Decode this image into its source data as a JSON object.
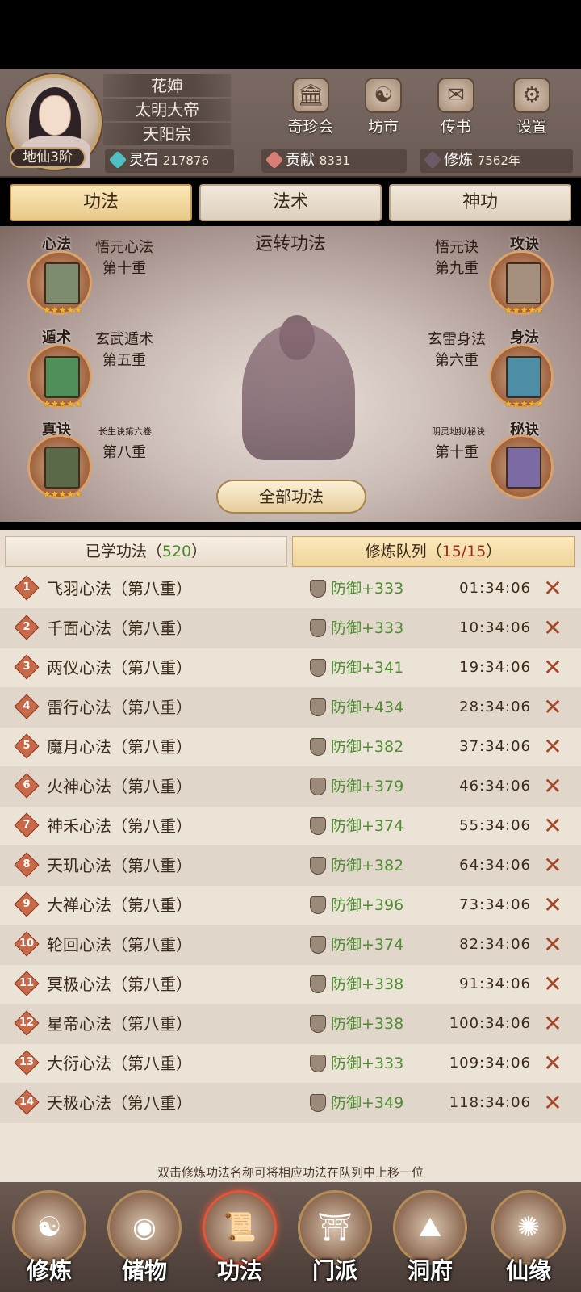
{
  "profile": {
    "name": "花婶",
    "title": "太明大帝",
    "sect": "天阳宗",
    "rank": "地仙3阶"
  },
  "top_buttons": [
    {
      "label": "奇珍会",
      "icon": "treasure-shop-icon"
    },
    {
      "label": "坊市",
      "icon": "market-icon"
    },
    {
      "label": "传书",
      "icon": "scroll-mail-icon"
    },
    {
      "label": "设置",
      "icon": "gear-icon"
    }
  ],
  "resources": {
    "spirit_stone": {
      "label": "灵石",
      "value": "217876",
      "color": "#4fbfc4"
    },
    "contribution": {
      "label": "贡献",
      "value": "8331",
      "color": "#d77f77"
    },
    "cultivation": {
      "label": "修炼",
      "value": "7562年",
      "color": "#6e5a66"
    }
  },
  "tabs": [
    {
      "label": "功法",
      "active": true
    },
    {
      "label": "法术",
      "active": false
    },
    {
      "label": "神功",
      "active": false
    }
  ],
  "scene": {
    "title": "运转功法",
    "slots": {
      "left": [
        {
          "tag": "心法",
          "name": "悟元心法",
          "level": "第十重",
          "stars": "★★★★★",
          "book_color": "#7c8c6c"
        },
        {
          "tag": "遁术",
          "name": "玄武遁术",
          "level": "第五重",
          "stars": "★★★★★",
          "book_color": "#4f8f5a"
        },
        {
          "tag": "真诀",
          "name": "长生诀第六卷",
          "level": "第八重",
          "stars": "★★★★★",
          "book_color": "#5a6a48"
        }
      ],
      "right": [
        {
          "tag": "攻诀",
          "name": "悟元诀",
          "level": "第九重",
          "stars": "★★★★★",
          "book_color": "#a58f7d"
        },
        {
          "tag": "身法",
          "name": "玄雷身法",
          "level": "第六重",
          "stars": "★★★★★",
          "book_color": "#4d8ea6"
        },
        {
          "tag": "秘诀",
          "name": "阴灵地狱秘诀",
          "level": "第十重",
          "stars": "",
          "book_color": "#7b6aa3"
        }
      ]
    },
    "all_button": "全部功法"
  },
  "subtabs": {
    "learned_label": "已学功法（",
    "learned_count": "520",
    "learned_close": "）",
    "queue_label": "修炼队列（",
    "queue_count": "15/15",
    "queue_close": "）"
  },
  "queue": [
    {
      "index": "1",
      "name": "飞羽心法（第八重）",
      "stat": "防御+333",
      "time": "01:34:06"
    },
    {
      "index": "2",
      "name": "千面心法（第八重）",
      "stat": "防御+333",
      "time": "10:34:06"
    },
    {
      "index": "3",
      "name": "两仪心法（第八重）",
      "stat": "防御+341",
      "time": "19:34:06"
    },
    {
      "index": "4",
      "name": "雷行心法（第八重）",
      "stat": "防御+434",
      "time": "28:34:06"
    },
    {
      "index": "5",
      "name": "魔月心法（第八重）",
      "stat": "防御+382",
      "time": "37:34:06"
    },
    {
      "index": "6",
      "name": "火神心法（第八重）",
      "stat": "防御+379",
      "time": "46:34:06"
    },
    {
      "index": "7",
      "name": "神禾心法（第八重）",
      "stat": "防御+374",
      "time": "55:34:06"
    },
    {
      "index": "8",
      "name": "天玑心法（第八重）",
      "stat": "防御+382",
      "time": "64:34:06"
    },
    {
      "index": "9",
      "name": "大禅心法（第八重）",
      "stat": "防御+396",
      "time": "73:34:06"
    },
    {
      "index": "10",
      "name": "轮回心法（第八重）",
      "stat": "防御+374",
      "time": "82:34:06"
    },
    {
      "index": "11",
      "name": "冥极心法（第八重）",
      "stat": "防御+338",
      "time": "91:34:06"
    },
    {
      "index": "12",
      "name": "星帝心法（第八重）",
      "stat": "防御+338",
      "time": "100:34:06"
    },
    {
      "index": "13",
      "name": "大衍心法（第八重）",
      "stat": "防御+333",
      "time": "109:34:06"
    },
    {
      "index": "14",
      "name": "天极心法（第八重）",
      "stat": "防御+349",
      "time": "118:34:06"
    }
  ],
  "hint": "双击修炼功法名称可将相应功法在队列中上移一位",
  "nav": [
    {
      "label": "修炼",
      "icon": "cultivate-icon",
      "glyph": "☯",
      "active": false
    },
    {
      "label": "储物",
      "icon": "storage-bag-icon",
      "glyph": "◉",
      "active": false
    },
    {
      "label": "功法",
      "icon": "technique-book-icon",
      "glyph": "📜",
      "active": true
    },
    {
      "label": "门派",
      "icon": "sect-gate-icon",
      "glyph": "⛩",
      "active": false
    },
    {
      "label": "洞府",
      "icon": "cave-mountain-icon",
      "glyph": "⛰",
      "active": false
    },
    {
      "label": "仙缘",
      "icon": "destiny-swirl-icon",
      "glyph": "✺",
      "active": false
    }
  ]
}
